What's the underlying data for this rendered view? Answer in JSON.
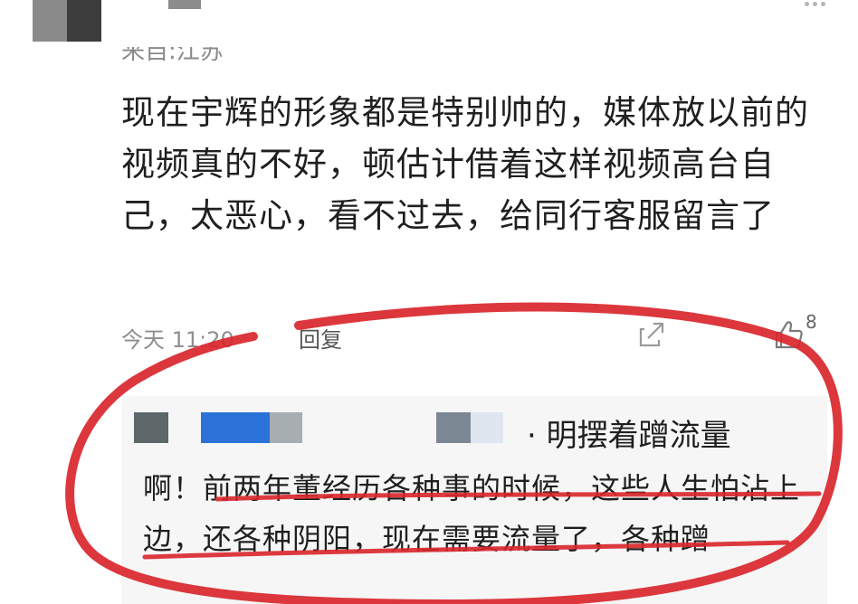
{
  "post": {
    "source_label": "来自:江苏",
    "comment_text": "现在宇辉的形象都是特别帅的，媒体放以前的视频真的不好，顿估计借着这样视频高台自己，太恶心，看不过去，给同行客服留言了",
    "time": "今天 11:20",
    "reply_label": "回复",
    "like_count": "8"
  },
  "reply": {
    "title_text": "· 明摆着蹭流量",
    "body_text": "啊！前两年董经历各种事的时候，这些人生怕沾上边，还各种阴阳，现在需要流量了，各种蹭"
  },
  "colors": {
    "annotation_red": "#d9262b",
    "blurred_blue": "#2a72d8",
    "reply_bg": "#f6f6f6",
    "muted_text": "#8e8e8e"
  },
  "icons": [
    "more-icon",
    "share-icon",
    "thumbs-up-icon"
  ]
}
